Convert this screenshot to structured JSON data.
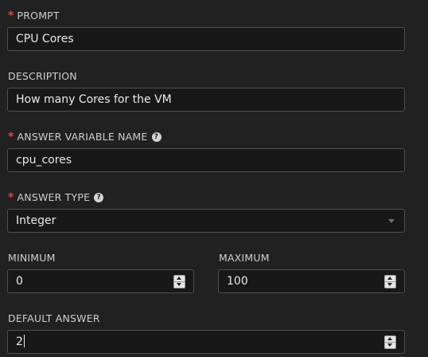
{
  "prompt": {
    "label": "PROMPT",
    "required_mark": "*",
    "value": "CPU Cores"
  },
  "description": {
    "label": "DESCRIPTION",
    "value": "How many Cores for the VM"
  },
  "answer_variable_name": {
    "label": "ANSWER VARIABLE NAME",
    "required_mark": "*",
    "help_icon": "question-circle-icon",
    "value": "cpu_cores"
  },
  "answer_type": {
    "label": "ANSWER TYPE",
    "required_mark": "*",
    "help_icon": "question-circle-icon",
    "selected": "Integer"
  },
  "minimum": {
    "label": "MINIMUM",
    "value": "0"
  },
  "maximum": {
    "label": "MAXIMUM",
    "value": "100"
  },
  "default_answer": {
    "label": "DEFAULT ANSWER",
    "value": "2"
  },
  "colors": {
    "background": "#212121",
    "field_background": "#181818",
    "field_border": "#505050",
    "required": "#e0453f",
    "label": "#cfcfcf",
    "text": "#eaeaea"
  }
}
